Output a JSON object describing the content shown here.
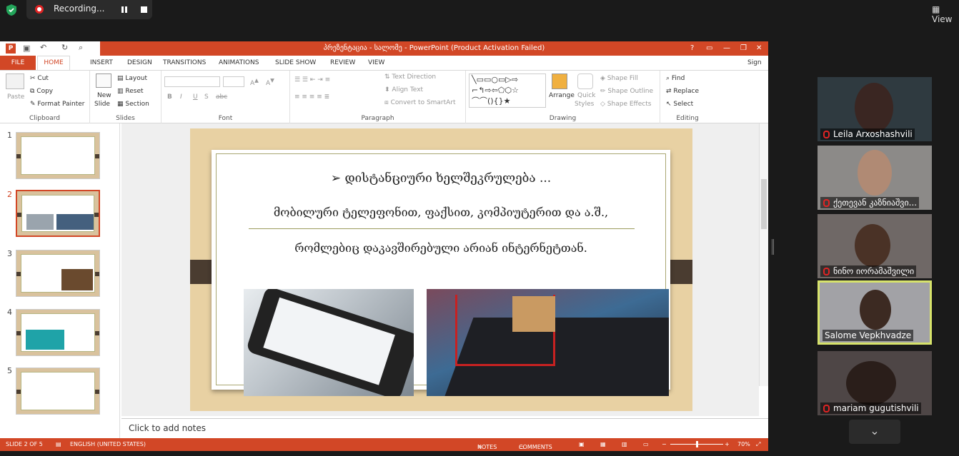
{
  "zoom_bar": {
    "recording_label": "Recording...",
    "view_label": "View"
  },
  "app": {
    "title": "პრეზენტაცია - სალომე -  PowerPoint (Product Activation Failed)",
    "sign_in": "Sign in",
    "window_help": "?"
  },
  "tabs": [
    "FILE",
    "HOME",
    "INSERT",
    "DESIGN",
    "TRANSITIONS",
    "ANIMATIONS",
    "SLIDE SHOW",
    "REVIEW",
    "VIEW"
  ],
  "ribbon": {
    "clipboard": {
      "label": "Clipboard",
      "paste": "Paste",
      "cut": "Cut",
      "copy": "Copy",
      "format_painter": "Format Painter"
    },
    "slides": {
      "label": "Slides",
      "new_slide": "New",
      "new_slide2": "Slide",
      "layout": "Layout",
      "reset": "Reset",
      "section": "Section"
    },
    "font": {
      "label": "Font",
      "bold": "B",
      "italic": "I",
      "underline": "U",
      "strike": "S",
      "shadow": "abc"
    },
    "paragraph": {
      "label": "Paragraph",
      "text_direction": "Text Direction",
      "align_text": "Align Text",
      "smartart": "Convert to SmartArt"
    },
    "drawing": {
      "label": "Drawing",
      "arrange": "Arrange",
      "quick_styles": "Quick",
      "quick_styles2": "Styles",
      "shape_fill": "Shape Fill",
      "shape_outline": "Shape Outline",
      "shape_effects": "Shape Effects"
    },
    "editing": {
      "label": "Editing",
      "find": "Find",
      "replace": "Replace",
      "select": "Select"
    }
  },
  "thumbnails": [
    "1",
    "2",
    "3",
    "4",
    "5"
  ],
  "slide": {
    "line1": "დისტანციური ხელშეკრულება ...",
    "line2": "მობილური ტელეფონით, ფაქსით, კომპიუტერით და ა.შ.,",
    "line3": "რომლებიც დაკავშირებული არიან ინტერნეტთან."
  },
  "notes_placeholder": "Click to add notes",
  "status": {
    "slide_of": "SLIDE 2 OF 5",
    "language": "ENGLISH (UNITED STATES)",
    "notes": "NOTES",
    "comments": "COMMENTS",
    "zoom": "70%",
    "zoom_fraction": 0.5
  },
  "participants": [
    {
      "name": "Leila Arxoshashvili"
    },
    {
      "name": "ქეთევან კაზნიაშვი..."
    },
    {
      "name": "ნინო იორამაშვილი"
    },
    {
      "name": "Salome Vepkhvadze"
    },
    {
      "name": "mariam gugutishvili"
    }
  ],
  "colors": {
    "accent": "#d24726",
    "active_speaker": "#d7e36b",
    "muted": "#e02424"
  }
}
